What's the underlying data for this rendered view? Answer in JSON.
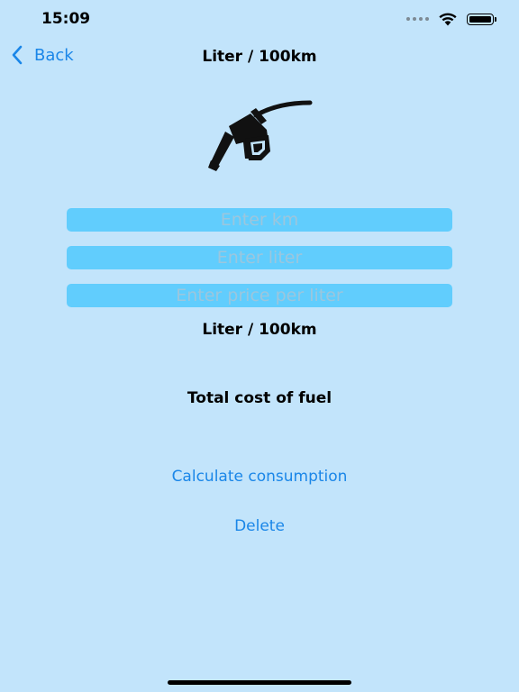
{
  "status_bar": {
    "time": "15:09"
  },
  "nav": {
    "back_label": "Back",
    "title": "Liter / 100km"
  },
  "icon": "fuel-pump-nozzle-icon",
  "inputs": {
    "km_placeholder": "Enter km",
    "liter_placeholder": "Enter liter",
    "price_placeholder": "Enter price per liter"
  },
  "results": {
    "consumption_label": "Liter / 100km",
    "total_cost_label": "Total cost of fuel"
  },
  "actions": {
    "calculate_label": "Calculate consumption",
    "delete_label": "Delete"
  },
  "colors": {
    "background": "#c2e4fb",
    "field": "#61cdfd",
    "accent": "#1a86e8"
  }
}
